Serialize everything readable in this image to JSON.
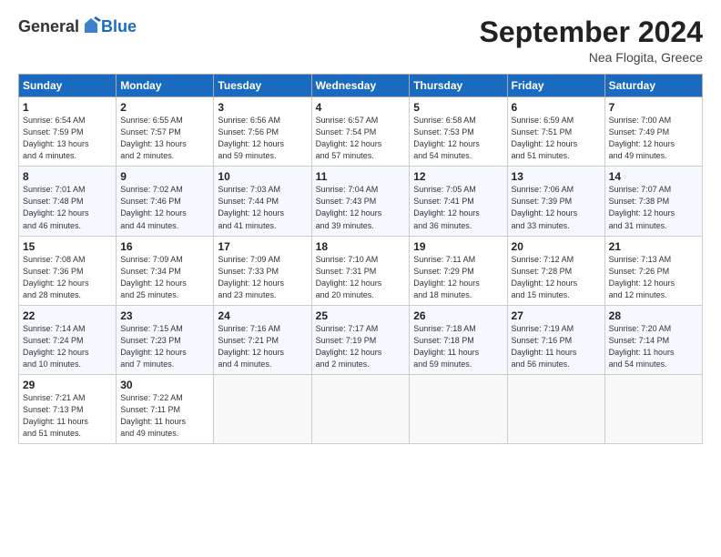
{
  "logo": {
    "general": "General",
    "blue": "Blue"
  },
  "title": "September 2024",
  "location": "Nea Flogita, Greece",
  "days_of_week": [
    "Sunday",
    "Monday",
    "Tuesday",
    "Wednesday",
    "Thursday",
    "Friday",
    "Saturday"
  ],
  "weeks": [
    [
      {
        "day": "1",
        "info": "Sunrise: 6:54 AM\nSunset: 7:59 PM\nDaylight: 13 hours\nand 4 minutes."
      },
      {
        "day": "2",
        "info": "Sunrise: 6:55 AM\nSunset: 7:57 PM\nDaylight: 13 hours\nand 2 minutes."
      },
      {
        "day": "3",
        "info": "Sunrise: 6:56 AM\nSunset: 7:56 PM\nDaylight: 12 hours\nand 59 minutes."
      },
      {
        "day": "4",
        "info": "Sunrise: 6:57 AM\nSunset: 7:54 PM\nDaylight: 12 hours\nand 57 minutes."
      },
      {
        "day": "5",
        "info": "Sunrise: 6:58 AM\nSunset: 7:53 PM\nDaylight: 12 hours\nand 54 minutes."
      },
      {
        "day": "6",
        "info": "Sunrise: 6:59 AM\nSunset: 7:51 PM\nDaylight: 12 hours\nand 51 minutes."
      },
      {
        "day": "7",
        "info": "Sunrise: 7:00 AM\nSunset: 7:49 PM\nDaylight: 12 hours\nand 49 minutes."
      }
    ],
    [
      {
        "day": "8",
        "info": "Sunrise: 7:01 AM\nSunset: 7:48 PM\nDaylight: 12 hours\nand 46 minutes."
      },
      {
        "day": "9",
        "info": "Sunrise: 7:02 AM\nSunset: 7:46 PM\nDaylight: 12 hours\nand 44 minutes."
      },
      {
        "day": "10",
        "info": "Sunrise: 7:03 AM\nSunset: 7:44 PM\nDaylight: 12 hours\nand 41 minutes."
      },
      {
        "day": "11",
        "info": "Sunrise: 7:04 AM\nSunset: 7:43 PM\nDaylight: 12 hours\nand 39 minutes."
      },
      {
        "day": "12",
        "info": "Sunrise: 7:05 AM\nSunset: 7:41 PM\nDaylight: 12 hours\nand 36 minutes."
      },
      {
        "day": "13",
        "info": "Sunrise: 7:06 AM\nSunset: 7:39 PM\nDaylight: 12 hours\nand 33 minutes."
      },
      {
        "day": "14",
        "info": "Sunrise: 7:07 AM\nSunset: 7:38 PM\nDaylight: 12 hours\nand 31 minutes."
      }
    ],
    [
      {
        "day": "15",
        "info": "Sunrise: 7:08 AM\nSunset: 7:36 PM\nDaylight: 12 hours\nand 28 minutes."
      },
      {
        "day": "16",
        "info": "Sunrise: 7:09 AM\nSunset: 7:34 PM\nDaylight: 12 hours\nand 25 minutes."
      },
      {
        "day": "17",
        "info": "Sunrise: 7:09 AM\nSunset: 7:33 PM\nDaylight: 12 hours\nand 23 minutes."
      },
      {
        "day": "18",
        "info": "Sunrise: 7:10 AM\nSunset: 7:31 PM\nDaylight: 12 hours\nand 20 minutes."
      },
      {
        "day": "19",
        "info": "Sunrise: 7:11 AM\nSunset: 7:29 PM\nDaylight: 12 hours\nand 18 minutes."
      },
      {
        "day": "20",
        "info": "Sunrise: 7:12 AM\nSunset: 7:28 PM\nDaylight: 12 hours\nand 15 minutes."
      },
      {
        "day": "21",
        "info": "Sunrise: 7:13 AM\nSunset: 7:26 PM\nDaylight: 12 hours\nand 12 minutes."
      }
    ],
    [
      {
        "day": "22",
        "info": "Sunrise: 7:14 AM\nSunset: 7:24 PM\nDaylight: 12 hours\nand 10 minutes."
      },
      {
        "day": "23",
        "info": "Sunrise: 7:15 AM\nSunset: 7:23 PM\nDaylight: 12 hours\nand 7 minutes."
      },
      {
        "day": "24",
        "info": "Sunrise: 7:16 AM\nSunset: 7:21 PM\nDaylight: 12 hours\nand 4 minutes."
      },
      {
        "day": "25",
        "info": "Sunrise: 7:17 AM\nSunset: 7:19 PM\nDaylight: 12 hours\nand 2 minutes."
      },
      {
        "day": "26",
        "info": "Sunrise: 7:18 AM\nSunset: 7:18 PM\nDaylight: 11 hours\nand 59 minutes."
      },
      {
        "day": "27",
        "info": "Sunrise: 7:19 AM\nSunset: 7:16 PM\nDaylight: 11 hours\nand 56 minutes."
      },
      {
        "day": "28",
        "info": "Sunrise: 7:20 AM\nSunset: 7:14 PM\nDaylight: 11 hours\nand 54 minutes."
      }
    ],
    [
      {
        "day": "29",
        "info": "Sunrise: 7:21 AM\nSunset: 7:13 PM\nDaylight: 11 hours\nand 51 minutes."
      },
      {
        "day": "30",
        "info": "Sunrise: 7:22 AM\nSunset: 7:11 PM\nDaylight: 11 hours\nand 49 minutes."
      },
      {
        "day": "",
        "info": ""
      },
      {
        "day": "",
        "info": ""
      },
      {
        "day": "",
        "info": ""
      },
      {
        "day": "",
        "info": ""
      },
      {
        "day": "",
        "info": ""
      }
    ]
  ]
}
